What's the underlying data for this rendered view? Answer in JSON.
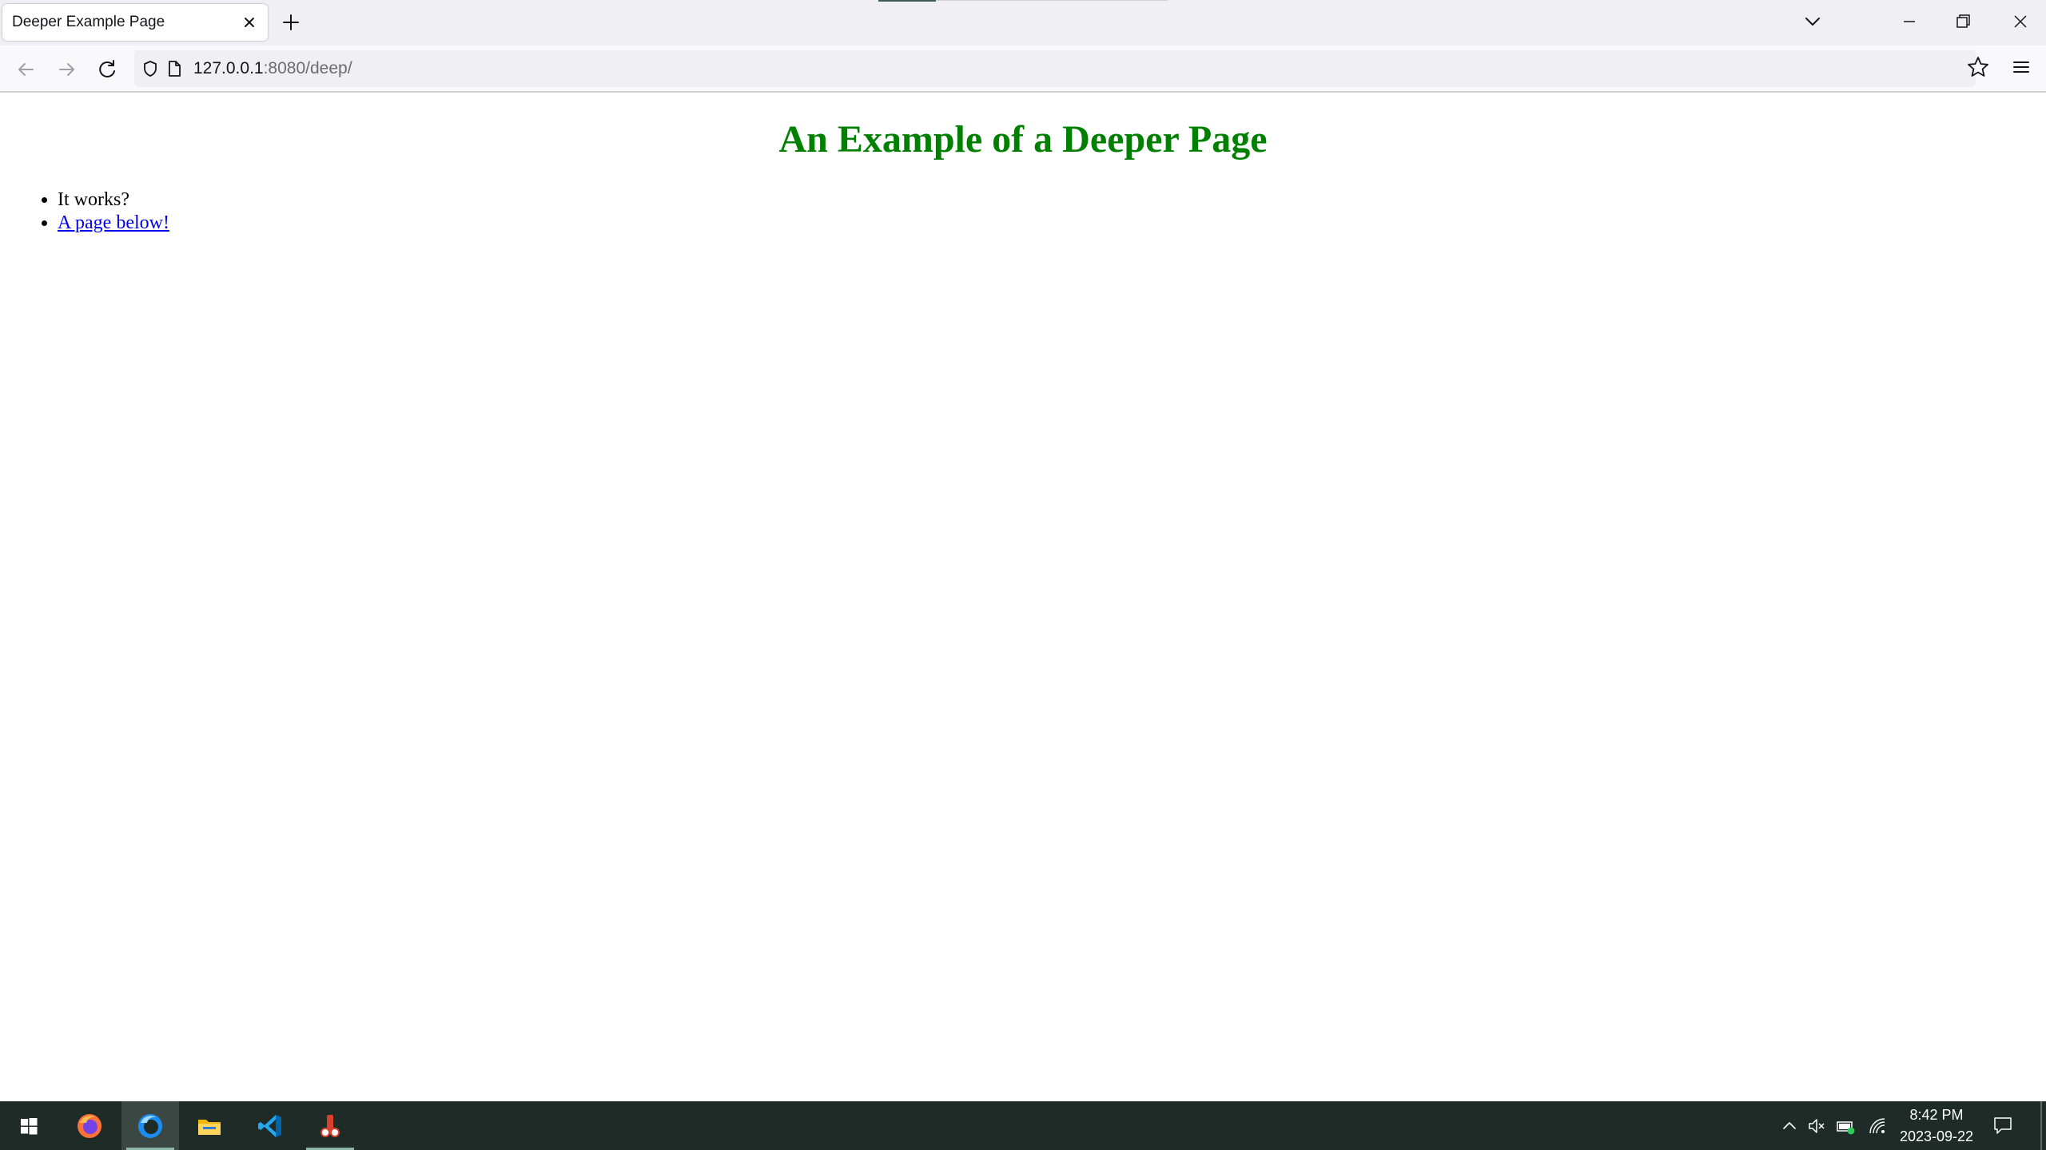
{
  "browser": {
    "tab": {
      "title": "Deeper Example Page"
    },
    "url": {
      "host": "127.0.0.1",
      "rest": ":8080/deep/"
    }
  },
  "page": {
    "heading": "An Example of a Deeper Page",
    "heading_color": "#008000",
    "items": [
      {
        "text": "It works?"
      },
      {
        "link": "A page below!"
      }
    ]
  },
  "taskbar": {
    "apps": [
      "windows-start-icon",
      "firefox-icon",
      "firefox-dev-icon",
      "file-explorer-icon",
      "vscode-icon",
      "app-icon"
    ],
    "clock": {
      "time": "8:42 PM",
      "date": "2023-09-22"
    }
  }
}
